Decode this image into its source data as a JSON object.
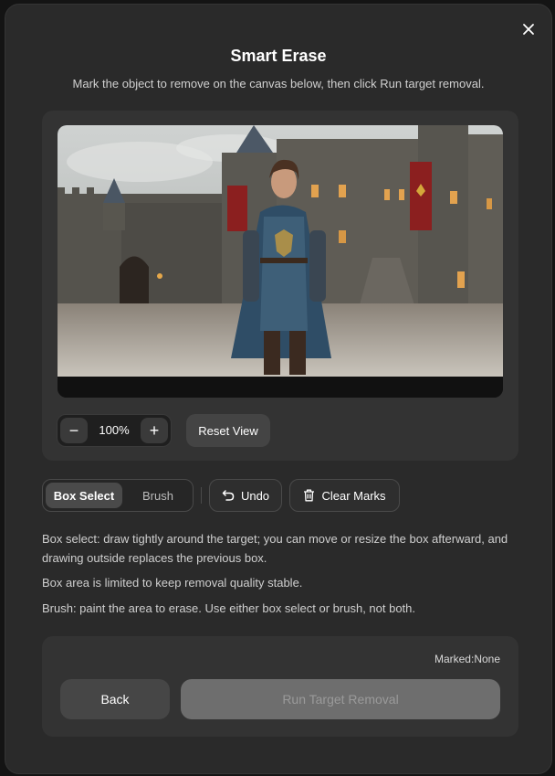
{
  "dialog": {
    "title": "Smart Erase",
    "subtitle": "Mark the object to remove on the canvas below, then click Run target removal.",
    "close_icon": "close-icon"
  },
  "canvas": {
    "image_description_icon": "castle-knight-photo"
  },
  "zoom": {
    "minus_label": "−",
    "value": "100%",
    "plus_label": "+",
    "reset_label": "Reset View"
  },
  "tools": {
    "box_select_label": "Box Select",
    "brush_label": "Brush",
    "active_mode": "Box Select",
    "undo_label": "Undo",
    "undo_icon": "undo-icon",
    "clear_label": "Clear Marks",
    "clear_icon": "trash-icon"
  },
  "help": {
    "line1": "Box select: draw tightly around the target; you can move or resize the box afterward, and drawing outside replaces the previous box.",
    "line2": "Box area is limited to keep removal quality stable.",
    "line3": "Brush: paint the area to erase. Use either box select or brush, not both."
  },
  "footer": {
    "marked_label": "Marked:",
    "marked_value": "None",
    "back_label": "Back",
    "run_label": "Run Target Removal"
  },
  "colors": {
    "dialog_bg": "#2a2a2a",
    "panel_bg": "#333333",
    "active_mode_bg": "#4a4a4a",
    "run_disabled_bg": "#6e6e6e",
    "banner_red": "#8b1f1f",
    "tunic_blue": "#3e5f78"
  }
}
